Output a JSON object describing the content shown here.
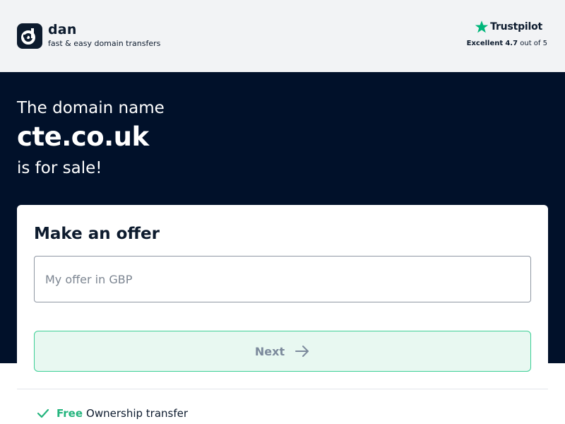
{
  "header": {
    "brand_name": "dan",
    "brand_tagline": "fast & easy domain transfers",
    "trustpilot": {
      "name": "Trustpilot",
      "rating_label": "Excellent",
      "score": "4.7",
      "out_of": "out of 5",
      "star_color": "#00b67a"
    }
  },
  "hero": {
    "pre_text": "The domain name",
    "domain": "cte.co.uk",
    "post_text": "is for sale!"
  },
  "offer_card": {
    "title": "Make an offer",
    "input_placeholder": "My offer in GBP",
    "input_value": "",
    "next_label": "Next",
    "features": [
      {
        "highlight": "Free",
        "text": "Ownership transfer"
      }
    ]
  },
  "colors": {
    "hero_bg": "#01112a",
    "accent_green": "#23b47d",
    "button_bg": "#e8f8f1"
  }
}
